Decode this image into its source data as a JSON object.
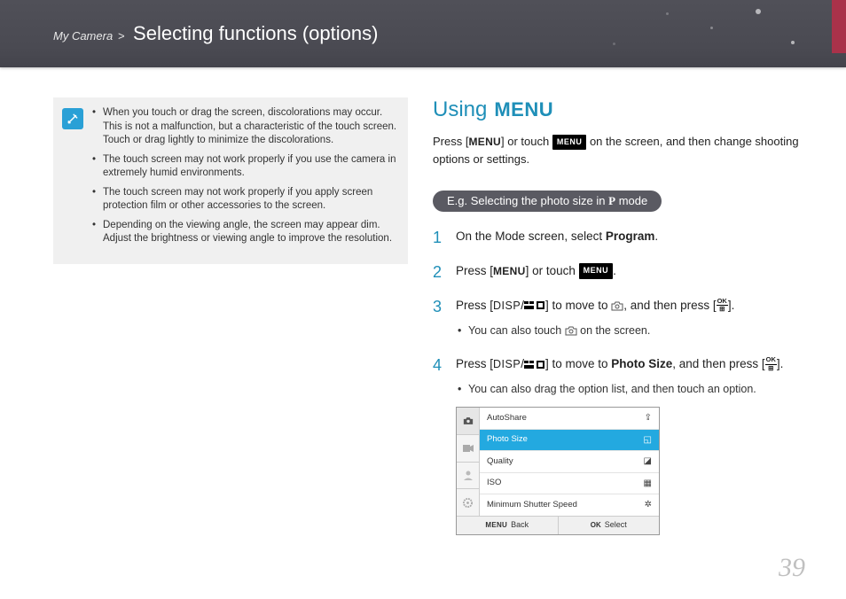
{
  "header": {
    "breadcrumb_root": "My Camera",
    "breadcrumb_sep": ">",
    "title": "Selecting functions (options)"
  },
  "note": {
    "items": [
      "When you touch or drag the screen, discolorations may occur. This is not a malfunction, but a characteristic of the touch screen. Touch or drag lightly to minimize the discolorations.",
      "The touch screen may not work properly if you use the camera in extremely humid environments.",
      "The touch screen may not work properly if you apply screen protection film or other accessories to the screen.",
      "Depending on the viewing angle, the screen may appear dim. Adjust the brightness or viewing angle to improve the resolution."
    ]
  },
  "section": {
    "using_label": "Using",
    "menu_glyph": "MENU",
    "intro_prefix": "Press [",
    "intro_mid": "] or touch ",
    "menu_btn_label": "MENU",
    "intro_suffix": " on the screen, and then change shooting options or settings."
  },
  "pill": {
    "prefix": "E.g. Selecting the photo size in ",
    "mode": "P",
    "suffix": " mode"
  },
  "steps": {
    "s1_pre": "On the Mode screen, select ",
    "s1_bold": "Program",
    "s1_post": ".",
    "s2_pre": "Press [",
    "s2_mid": "] or touch ",
    "s2_post": ".",
    "s3_pre": "Press [",
    "s3_disp": "DISP",
    "s3_slash": "/",
    "s3_mid": "] to move to ",
    "s3_mid2": ", and then press [",
    "s3_post": "].",
    "s3_sub": "You can also touch ",
    "s3_sub_post": " on the screen.",
    "s4_pre": "Press [",
    "s4_mid": "] to move to ",
    "s4_bold": "Photo Size",
    "s4_mid2": ", and then press [",
    "s4_post": "].",
    "s4_sub": "You can also drag the option list, and then touch an option.",
    "ok_top": "OK",
    "ok_bot": "⊞"
  },
  "ui": {
    "rows": [
      {
        "label": "AutoShare",
        "icon": "share-icon",
        "selected": false
      },
      {
        "label": "Photo Size",
        "icon": "aspect-icon",
        "selected": true
      },
      {
        "label": "Quality",
        "icon": "quality-icon",
        "selected": false
      },
      {
        "label": "ISO",
        "icon": "iso-icon",
        "selected": false
      },
      {
        "label": "Minimum Shutter Speed",
        "icon": "shutter-icon",
        "selected": false
      }
    ],
    "footer_back_key": "MENU",
    "footer_back": "Back",
    "footer_select_key": "OK",
    "footer_select": "Select"
  },
  "page_number": "39"
}
